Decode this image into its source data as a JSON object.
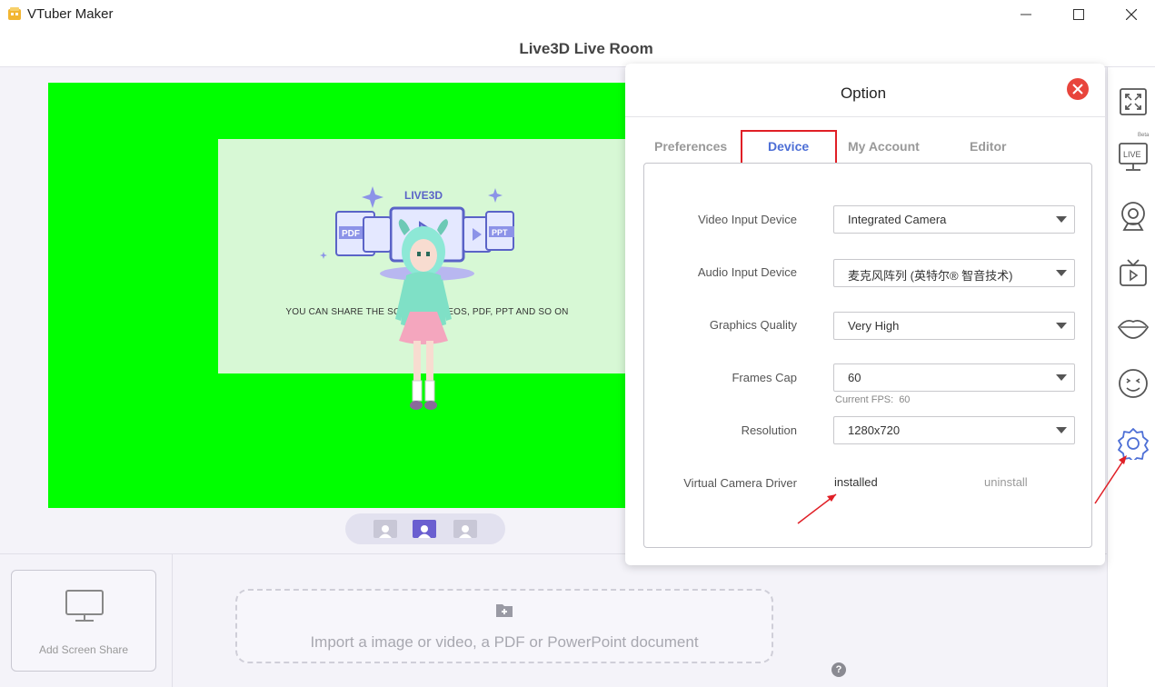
{
  "app": {
    "title": "VTuber Maker",
    "room_title": "Live3D Live Room"
  },
  "stage": {
    "background_color": "#00ff00",
    "share_logo_text": "LIVE3D",
    "share_hint": "YOU CAN SHARE THE SCREEN, VIDEOS, PDF, PPT AND SO ON",
    "pdf_label": "PDF",
    "ppt_label": "PPT",
    "view_modes": [
      "full-body",
      "half-body",
      "portrait"
    ],
    "active_view_mode": "half-body"
  },
  "bottom": {
    "add_screen_share": "Add  Screen Share",
    "import_label": "Import a image or video,  a PDF or PowerPoint document",
    "help": "?"
  },
  "sidebar": {
    "icons": [
      "fullscreen-icon",
      "live-icon",
      "webcam-icon",
      "tv-icon",
      "lips-icon",
      "face-icon",
      "settings-icon"
    ],
    "beta_label": "Beta",
    "live_label": "LIVE"
  },
  "dialog": {
    "title": "Option",
    "tabs": [
      {
        "label": "Preferences"
      },
      {
        "label": "Device"
      },
      {
        "label": "My Account"
      },
      {
        "label": "Editor"
      }
    ],
    "active_tab": "Device",
    "rows": {
      "video_input": {
        "label": "Video Input Device",
        "value": "Integrated Camera"
      },
      "audio_input": {
        "label": "Audio Input Device",
        "value": "麦克风阵列 (英特尔® 智音技术)"
      },
      "graphics": {
        "label": "Graphics Quality",
        "value": "Very High"
      },
      "frames_cap": {
        "label": "Frames Cap",
        "value": "60"
      },
      "current_fps_label": "Current FPS:",
      "current_fps_value": "60",
      "resolution": {
        "label": "Resolution",
        "value": "1280x720"
      },
      "virtual_camera": {
        "label": "Virtual Camera Driver",
        "status": "installed",
        "action": "uninstall"
      }
    }
  },
  "colors": {
    "accent": "#4d6fd6",
    "highlight_box": "#e01f26",
    "close_button": "#e8453c",
    "annotation_arrow": "#e01f26",
    "icon_blue": "#4d6fd6"
  }
}
